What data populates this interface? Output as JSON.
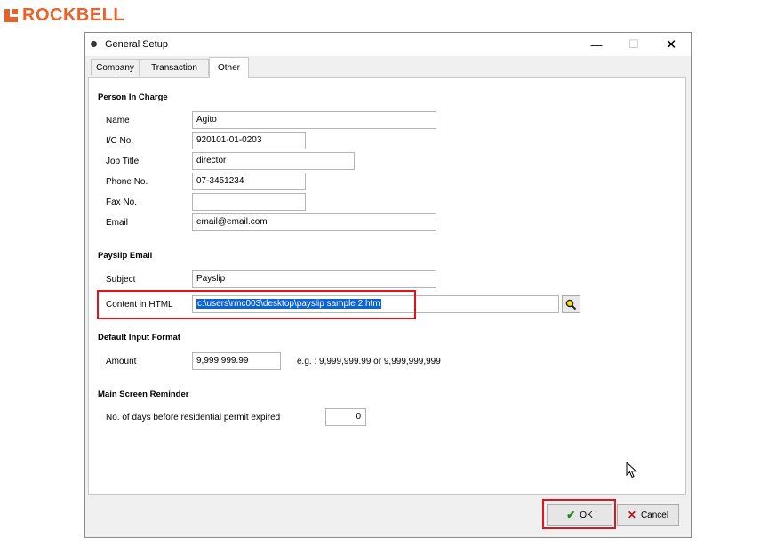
{
  "brand": {
    "name": "ROCKBELL",
    "color": "#e8622a"
  },
  "window": {
    "title": "General Setup",
    "controls": {
      "minimize": "—",
      "maximize": "☐",
      "close": "✕"
    }
  },
  "tabs": {
    "company": "Company",
    "transaction": "Transaction",
    "other": "Other",
    "active": "Other"
  },
  "person_in_charge": {
    "heading": "Person In Charge",
    "name_label": "Name",
    "name_value": "Agito",
    "ic_label": "I/C No.",
    "ic_value": "920101-01-0203",
    "job_label": "Job Title",
    "job_value": "director",
    "phone_label": "Phone No.",
    "phone_value": "07-3451234",
    "fax_label": "Fax No.",
    "fax_value": "",
    "email_label": "Email",
    "email_value": "email@email.com"
  },
  "payslip_email": {
    "heading": "Payslip Email",
    "subject_label": "Subject",
    "subject_value": "Payslip",
    "content_label": "Content in HTML",
    "content_value": "c:\\users\\rmc003\\desktop\\payslip sample 2.htm"
  },
  "default_input_format": {
    "heading": "Default Input Format",
    "amount_label": "Amount",
    "amount_value": "9,999,999.99",
    "amount_hint": "e.g. : 9,999,999.99 or 9,999,999,999"
  },
  "main_screen_reminder": {
    "heading": "Main Screen Reminder",
    "days_label": "No. of days before residential permit expired",
    "days_value": "0"
  },
  "buttons": {
    "ok_label": "OK",
    "cancel_label": "Cancel"
  },
  "colors": {
    "highlight_box": "#e0141c",
    "selection": "#0a64d8",
    "ok_check": "#1a8a1a",
    "cancel_x": "#c0101a"
  }
}
